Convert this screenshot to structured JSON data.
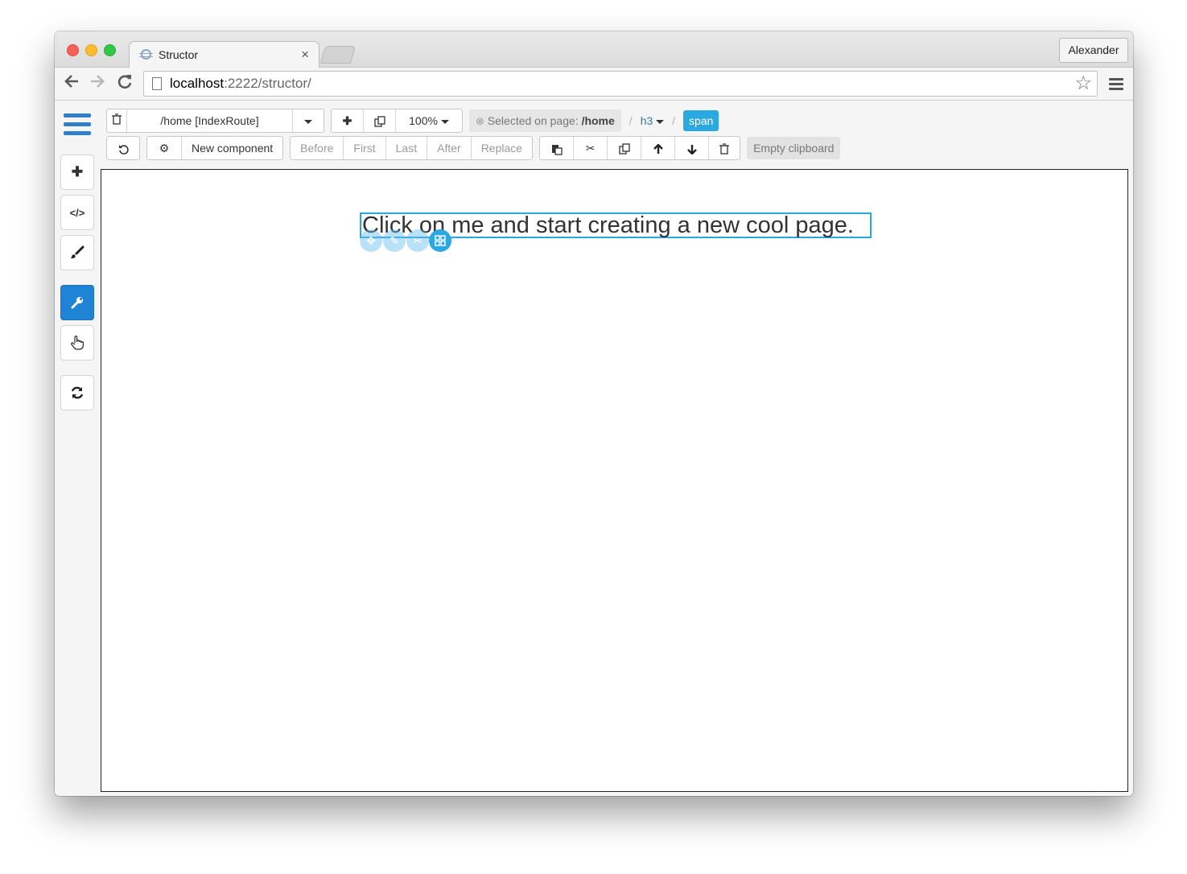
{
  "browser": {
    "tab_title": "Structor",
    "tab_close": "×",
    "profile_name": "Alexander",
    "url_host": "localhost",
    "url_rest": ":2222/structor/",
    "icons": [
      "back-icon",
      "forward-icon",
      "reload-icon",
      "page-icon",
      "star-icon",
      "menu-icon"
    ]
  },
  "toolbar": {
    "route_select_value": "/home [IndexRoute]",
    "zoom_value": "100%",
    "selected_label": "Selected on page:",
    "selected_page": "/home",
    "crumb_sep": "/",
    "crumb_h3": "h3",
    "crumb_span": "span",
    "new_component_label": "New component",
    "insert_before": "Before",
    "insert_first": "First",
    "insert_last": "Last",
    "insert_after": "After",
    "insert_replace": "Replace",
    "empty_clipboard_label": "Empty clipboard"
  },
  "sidebar": {
    "items": [
      {
        "name": "add-icon",
        "glyph": "✚"
      },
      {
        "name": "code-icon",
        "glyph": "</>"
      },
      {
        "name": "brush-icon",
        "glyph": "🖌"
      },
      {
        "name": "wrench-icon",
        "glyph": "🔧",
        "active": true
      },
      {
        "name": "hand-pointer-icon",
        "glyph": "☝"
      },
      {
        "name": "refresh-icon",
        "glyph": "⟳"
      }
    ]
  },
  "canvas": {
    "heading_text": "Click on me and start creating a new cool page."
  },
  "colors": {
    "accent": "#1f84d6",
    "selection": "#29a6de",
    "breadcrumb_link": "#3278b9"
  }
}
